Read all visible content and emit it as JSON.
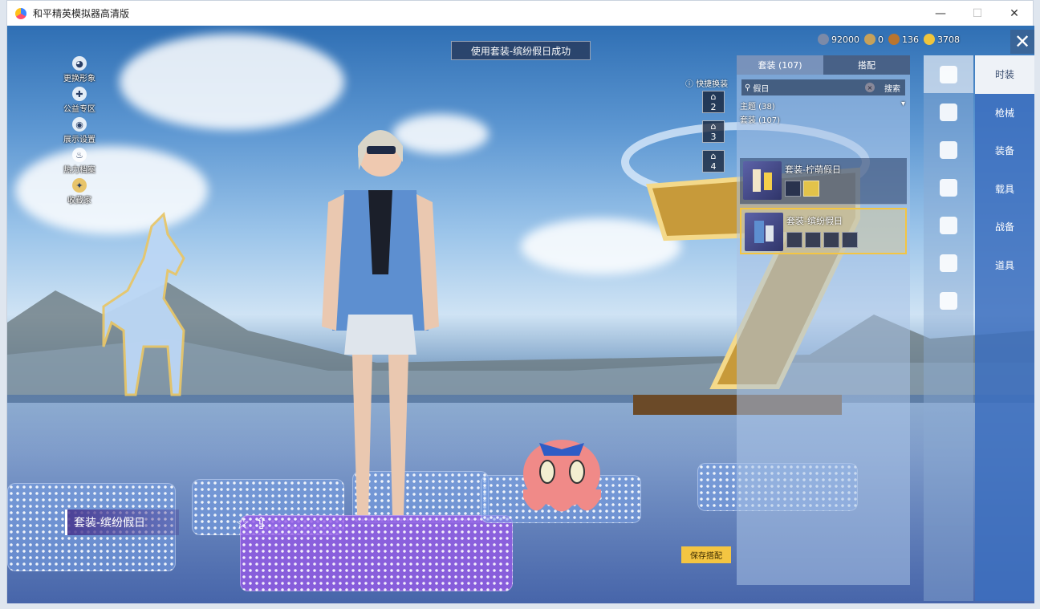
{
  "window": {
    "title": "和平精英模拟器高清版",
    "minimize": "—",
    "maximize": "☐",
    "close": "✕"
  },
  "left_menu": [
    {
      "label": "更换形象",
      "icon": "person-icon"
    },
    {
      "label": "公益专区",
      "icon": "puzzle-icon"
    },
    {
      "label": "展示设置",
      "icon": "eye-icon"
    },
    {
      "label": "热力档案",
      "icon": "flame-icon"
    },
    {
      "label": "收藏家",
      "icon": "collector-badge-icon"
    }
  ],
  "notice": "使用套装-缤纷假日成功",
  "currency": [
    {
      "value": "92000",
      "color": "#7b8aa8"
    },
    {
      "value": "0",
      "color": "#c6a15a"
    },
    {
      "value": "136",
      "color": "#b9752f"
    },
    {
      "value": "3708",
      "color": "#f0c53c"
    }
  ],
  "close_label": "✕",
  "quick_change": {
    "label": "快捷换装",
    "slots": [
      "2",
      "3",
      "4"
    ]
  },
  "panel": {
    "tabs": [
      "套装 (107)",
      "搭配"
    ],
    "search": {
      "value": "假日",
      "clear": "×",
      "button": "搜索"
    },
    "filters": {
      "theme": "主题 (38)",
      "suits": "套装 (107)"
    },
    "items": [
      {
        "name": "套装-柠萌假日",
        "selected": false
      },
      {
        "name": "套装-缤纷假日",
        "selected": true,
        "check": "✓"
      }
    ]
  },
  "categories": [
    "时装",
    "枪械",
    "装备",
    "载具",
    "战备",
    "道具"
  ],
  "outfit_name": "套装-缤纷假日",
  "fav_icons": "☆ ⇪",
  "save_button": "保存搭配"
}
